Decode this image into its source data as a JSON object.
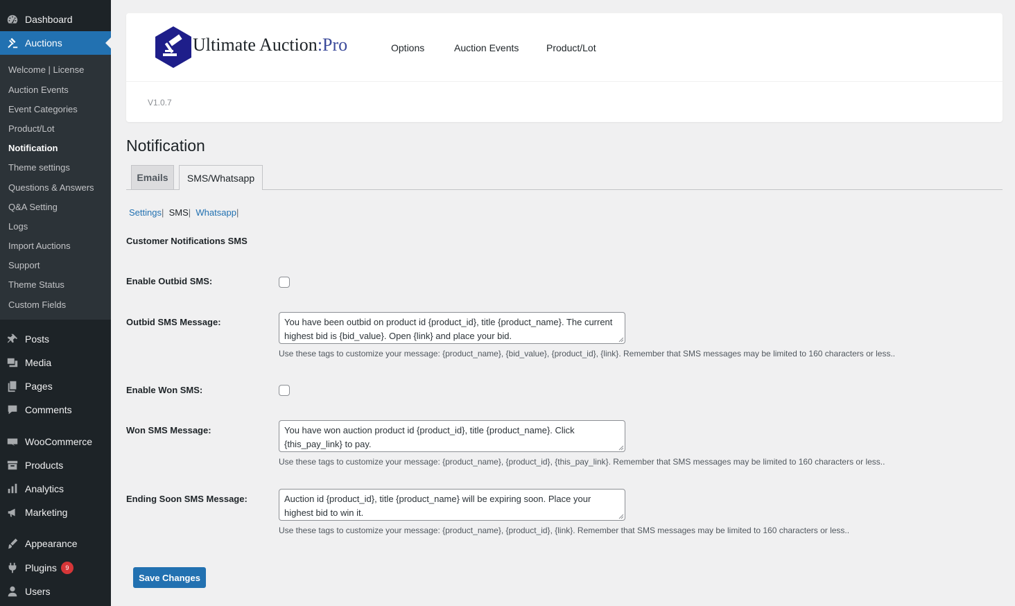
{
  "sidebar": {
    "dashboard": "Dashboard",
    "auctions": "Auctions",
    "submenu": [
      "Welcome | License",
      "Auction Events",
      "Event Categories",
      "Product/Lot",
      "Notification",
      "Theme settings",
      "Questions & Answers",
      "Q&A Setting",
      "Logs",
      "Import Auctions",
      "Support",
      "Theme Status",
      "Custom Fields"
    ],
    "posts": "Posts",
    "media": "Media",
    "pages": "Pages",
    "comments": "Comments",
    "woocommerce": "WooCommerce",
    "products": "Products",
    "analytics": "Analytics",
    "marketing": "Marketing",
    "appearance": "Appearance",
    "plugins": "Plugins",
    "plugins_badge": "9",
    "users": "Users"
  },
  "header": {
    "brand_main": "Ultimate Auction",
    "brand_sep": ":",
    "brand_pro": "Pro",
    "nav": [
      "Options",
      "Auction Events",
      "Product/Lot"
    ],
    "version": "V1.0.7"
  },
  "page_title": "Notification",
  "tabs": [
    "Emails",
    "SMS/Whatsapp"
  ],
  "subnav": {
    "settings": "Settings",
    "sms": "SMS",
    "whatsapp": "Whatsapp",
    "sep": "|"
  },
  "section_title": "Customer Notifications SMS",
  "fields": {
    "enable_outbid_label": "Enable Outbid SMS:",
    "outbid_msg_label": "Outbid SMS Message:",
    "outbid_msg_value": "You have been outbid on product id {product_id}, title {product_name}. The current highest bid is {bid_value}. Open {link} and place your bid.",
    "outbid_desc": "Use these tags to customize your message: {product_name}, {bid_value}, {product_id}, {link}. Remember that SMS messages may be limited to 160 characters or less..",
    "enable_won_label": "Enable Won SMS:",
    "won_msg_label": "Won SMS Message:",
    "won_msg_value": "You have won auction product id {product_id}, title {product_name}. Click {this_pay_link} to pay.",
    "won_desc": "Use these tags to customize your message: {product_name}, {product_id}, {this_pay_link}. Remember that SMS messages may be limited to 160 characters or less..",
    "ending_msg_label": "Ending Soon SMS Message:",
    "ending_msg_value": "Auction id {product_id}, title {product_name} will be expiring soon. Place your highest bid to win it.",
    "ending_desc": "Use these tags to customize your message: {product_name}, {product_id}, {link}. Remember that SMS messages may be limited to 160 characters or less.."
  },
  "save_label": "Save Changes",
  "colors": {
    "accent": "#2271b1",
    "sidebar": "#1d2327",
    "submenu": "#2c3338",
    "logo": "#1e1e8a"
  }
}
